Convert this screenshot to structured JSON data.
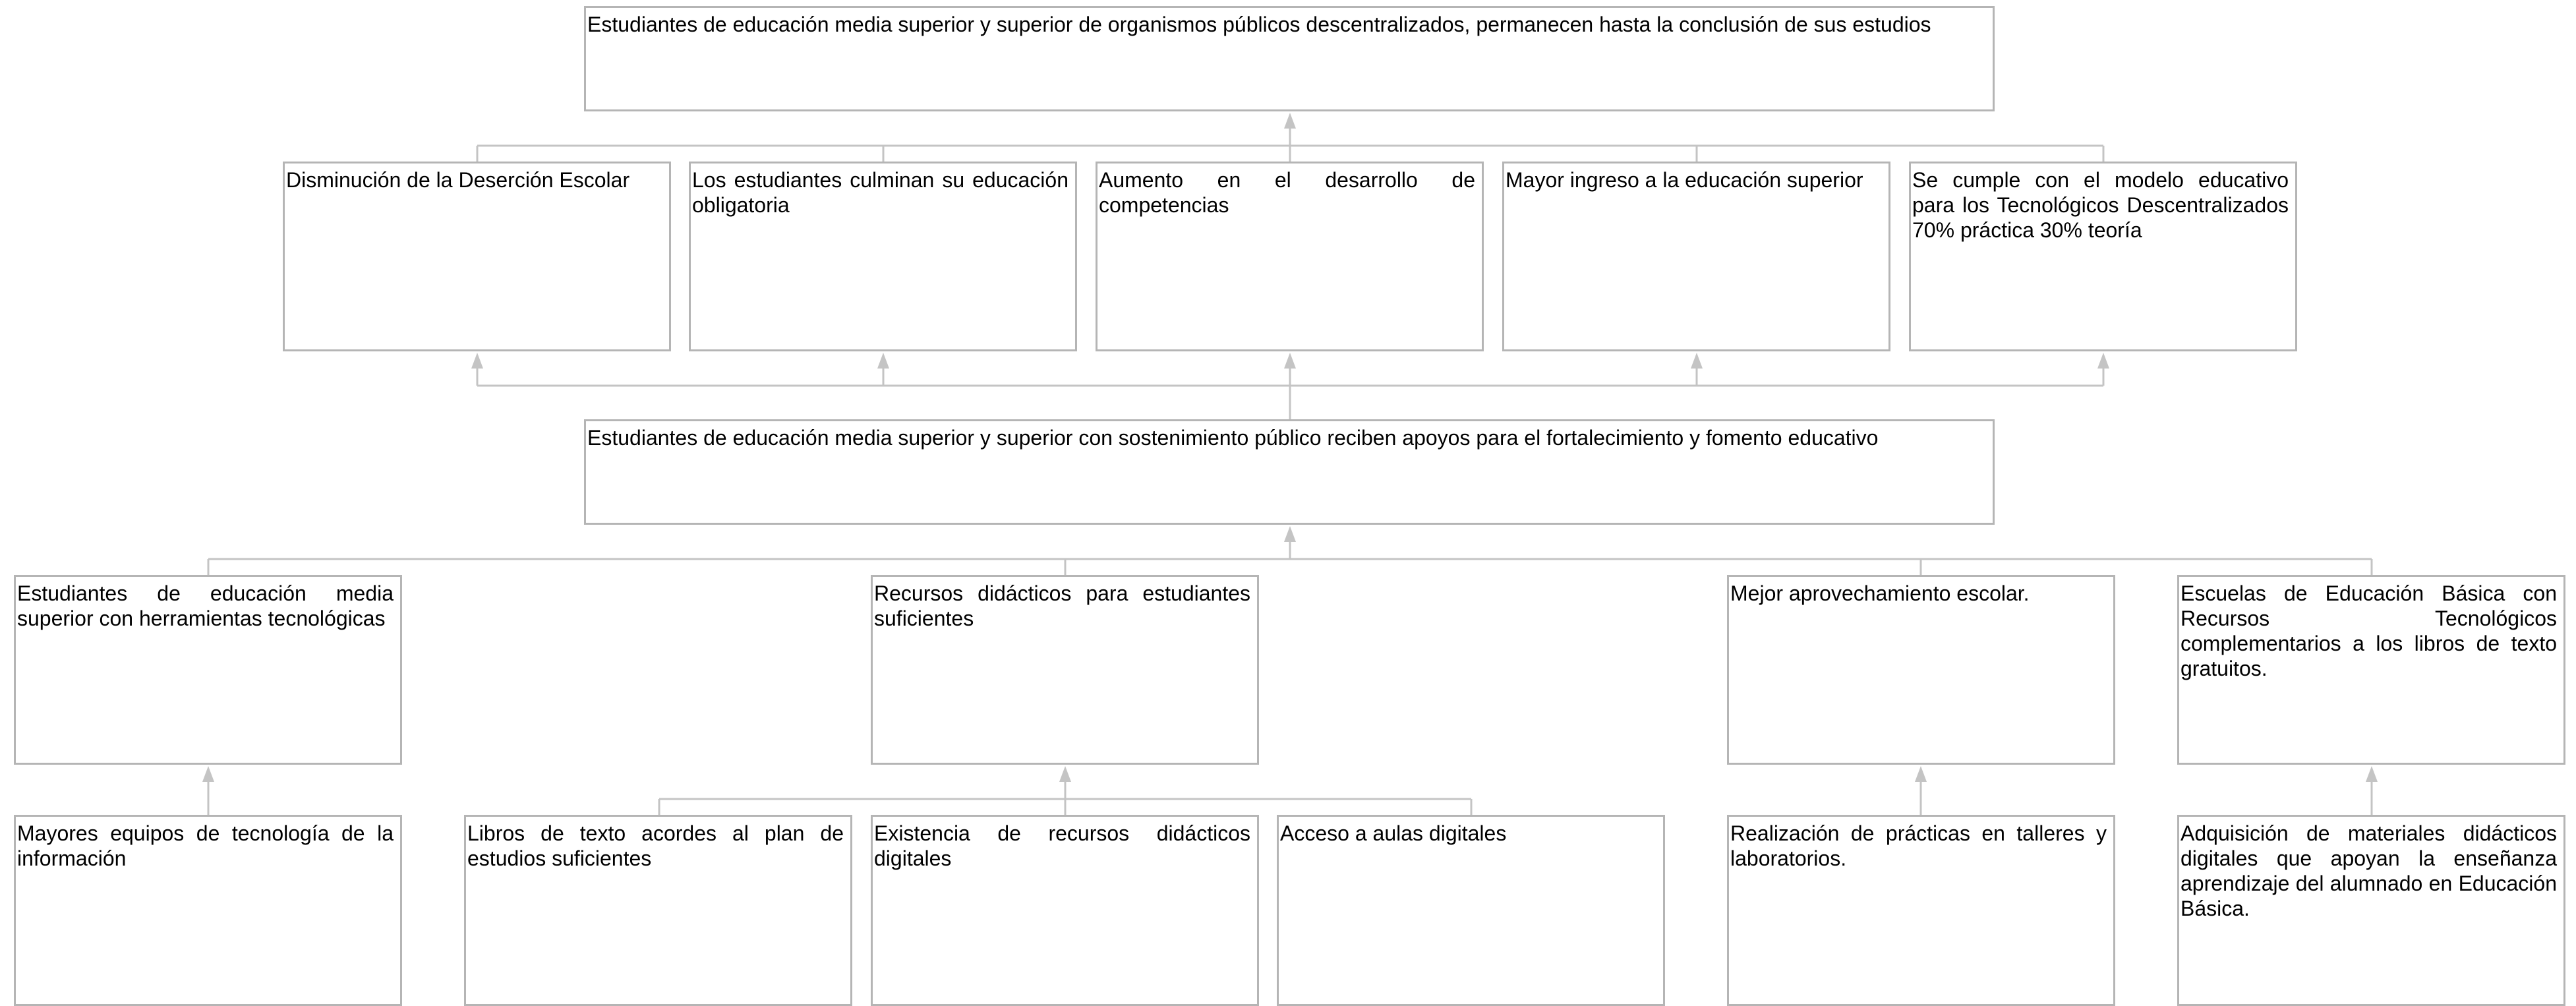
{
  "colors": {
    "connector": "#c4c4c4",
    "box_border": "#b5b5b5",
    "text": "#000000"
  },
  "nodes": {
    "purpose": "Estudiantes de educación media superior y superior de organismos públicos descentralizados, permanecen hasta la conclusión de sus estudios",
    "effect_1": "Disminución de la Deserción Escolar",
    "effect_2": "Los estudiantes culminan su educación obligatoria",
    "effect_3": "Aumento en el desarrollo de competencias",
    "effect_4": "Mayor ingreso a la educación superior",
    "effect_5": "Se cumple con el modelo educativo para los Tecnológicos Descentralizados 70% práctica 30% teoría",
    "central": "Estudiantes de educación media superior y superior con sostenimiento público  reciben apoyos para el fortalecimiento y fomento educativo",
    "comp_1": "Estudiantes de educación media superior con herramientas tecnológicas",
    "comp_2": "Recursos didácticos para estudiantes suficientes",
    "comp_3": "Mejor aprovechamiento escolar.",
    "comp_4": "Escuelas de Educación Básica con Recursos Tecnológicos complementarios a los libros de texto gratuitos.",
    "act_1": "Mayores equipos de tecnología de la información",
    "act_2": "Libros de texto acordes al plan de estudios suficientes",
    "act_3": "Existencia de recursos didácticos digitales",
    "act_4": "Acceso a aulas digitales",
    "act_5": "Realización de prácticas en talleres y laboratorios.",
    "act_6": "Adquisición de materiales didácticos digitales que apoyan la enseñanza aprendizaje del alumnado en Educación Básica."
  }
}
